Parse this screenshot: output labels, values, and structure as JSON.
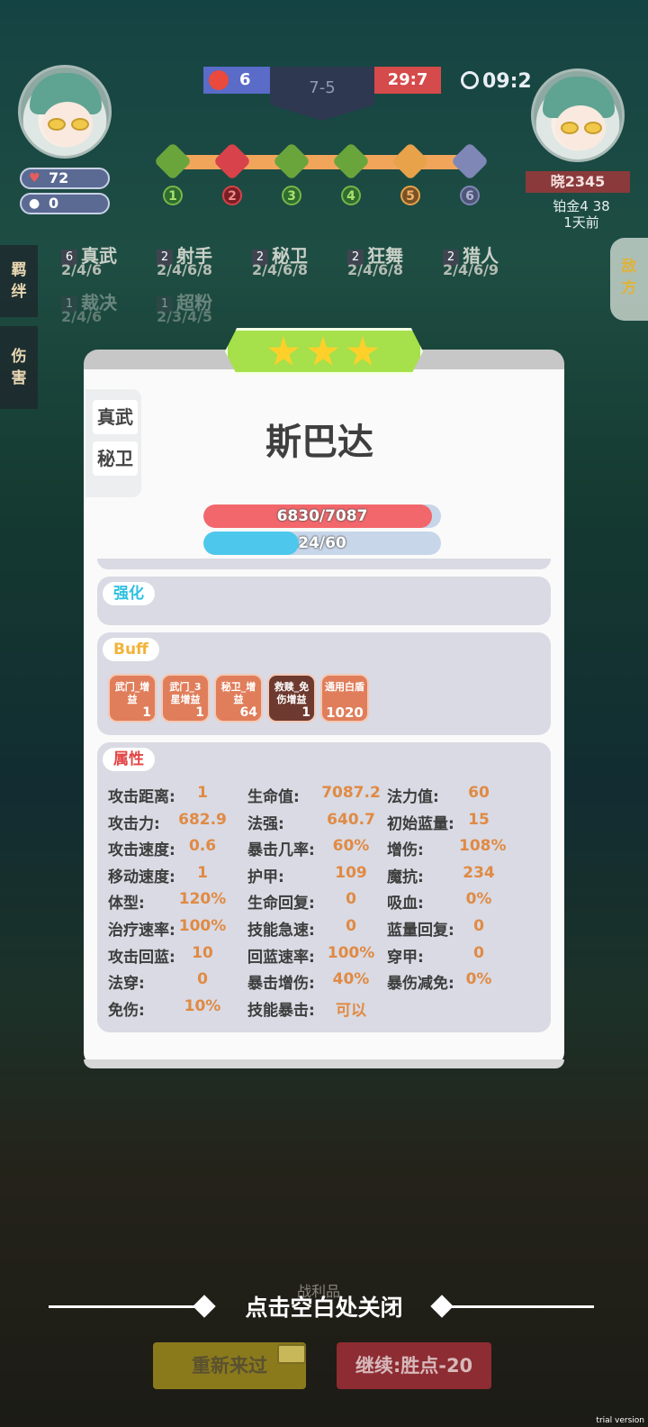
{
  "hud": {
    "player_hp": "72",
    "player_coins": "0",
    "score_left": "6",
    "round": "7-5",
    "score_right": "29:7",
    "timer": "09:2",
    "stages": [
      "1",
      "2",
      "3",
      "4",
      "5",
      "6"
    ]
  },
  "enemy": {
    "name": "晓2345",
    "rank": "铂金4 38",
    "last_seen": "1天前"
  },
  "side_tabs": {
    "synergy": "羁绊",
    "damage": "伤害",
    "enemy": "敌方"
  },
  "synergies": [
    {
      "level": "6",
      "name": "真武",
      "points": "2/4/6"
    },
    {
      "level": "2",
      "name": "射手",
      "points": "2/4/6/8"
    },
    {
      "level": "2",
      "name": "秘卫",
      "points": "2/4/6/8"
    },
    {
      "level": "2",
      "name": "狂舞",
      "points": "2/4/6/8"
    },
    {
      "level": "2",
      "name": "猎人",
      "points": "2/4/6/9"
    },
    {
      "level": "1",
      "name": "裁决",
      "points": "2/4/6"
    },
    {
      "level": "1",
      "name": "超粉",
      "points": "2/3/4/5"
    }
  ],
  "card": {
    "stars": 3,
    "traits": [
      "真武",
      "秘卫"
    ],
    "hero_name": "斯巴达",
    "hp_text": "6830/7087",
    "hp_fraction": 0.964,
    "mana_text": "24/60",
    "mana_fraction": 0.4,
    "section_enhance": "强化",
    "section_buff": "Buff",
    "section_attrs": "属性",
    "buffs": [
      {
        "name": "武门_增益",
        "count": "1"
      },
      {
        "name": "武门_3星增益",
        "count": "1"
      },
      {
        "name": "秘卫_增益",
        "count": "64"
      },
      {
        "name": "救赎_免伤增益",
        "count": "1"
      },
      {
        "name": "通用白盾",
        "count": "1020"
      }
    ],
    "attributes": [
      [
        {
          "k": "攻击距离:",
          "v": "1"
        },
        {
          "k": "生命值:",
          "v": "7087.2"
        },
        {
          "k": "法力值:",
          "v": "60"
        }
      ],
      [
        {
          "k": "攻击力:",
          "v": "682.9"
        },
        {
          "k": "法强:",
          "v": "640.7"
        },
        {
          "k": "初始蓝量:",
          "v": "15"
        }
      ],
      [
        {
          "k": "攻击速度:",
          "v": "0.6"
        },
        {
          "k": "暴击几率:",
          "v": "60%"
        },
        {
          "k": "增伤:",
          "v": "108%"
        }
      ],
      [
        {
          "k": "移动速度:",
          "v": "1"
        },
        {
          "k": "护甲:",
          "v": "109"
        },
        {
          "k": "魔抗:",
          "v": "234"
        }
      ],
      [
        {
          "k": "体型:",
          "v": "120%"
        },
        {
          "k": "生命回复:",
          "v": "0"
        },
        {
          "k": "吸血:",
          "v": "0%"
        }
      ],
      [
        {
          "k": "治疗速率:",
          "v": "100%"
        },
        {
          "k": "技能急速:",
          "v": "0"
        },
        {
          "k": "蓝量回复:",
          "v": "0"
        }
      ],
      [
        {
          "k": "攻击回蓝:",
          "v": "10"
        },
        {
          "k": "回蓝速率:",
          "v": "100%"
        },
        {
          "k": "穿甲:",
          "v": "0"
        }
      ],
      [
        {
          "k": "法穿:",
          "v": "0"
        },
        {
          "k": "暴击增伤:",
          "v": "40%"
        },
        {
          "k": "暴伤减免:",
          "v": "0%"
        }
      ],
      [
        {
          "k": "免伤:",
          "v": "10%"
        },
        {
          "k": "技能暴击:",
          "v": "可以"
        }
      ]
    ]
  },
  "bottom": {
    "loot_label": "战利品",
    "close_hint": "点击空白处关闭",
    "retry_label": "重新来过",
    "continue_label": "继续:胜点-20",
    "watermark": "trial version"
  },
  "colors": {
    "hp_bar": "#f2676b",
    "mana_bar": "#4dc8ec",
    "attr_value": "#e08a44",
    "star": "#ffd02a",
    "banner": "#a6e04a"
  }
}
